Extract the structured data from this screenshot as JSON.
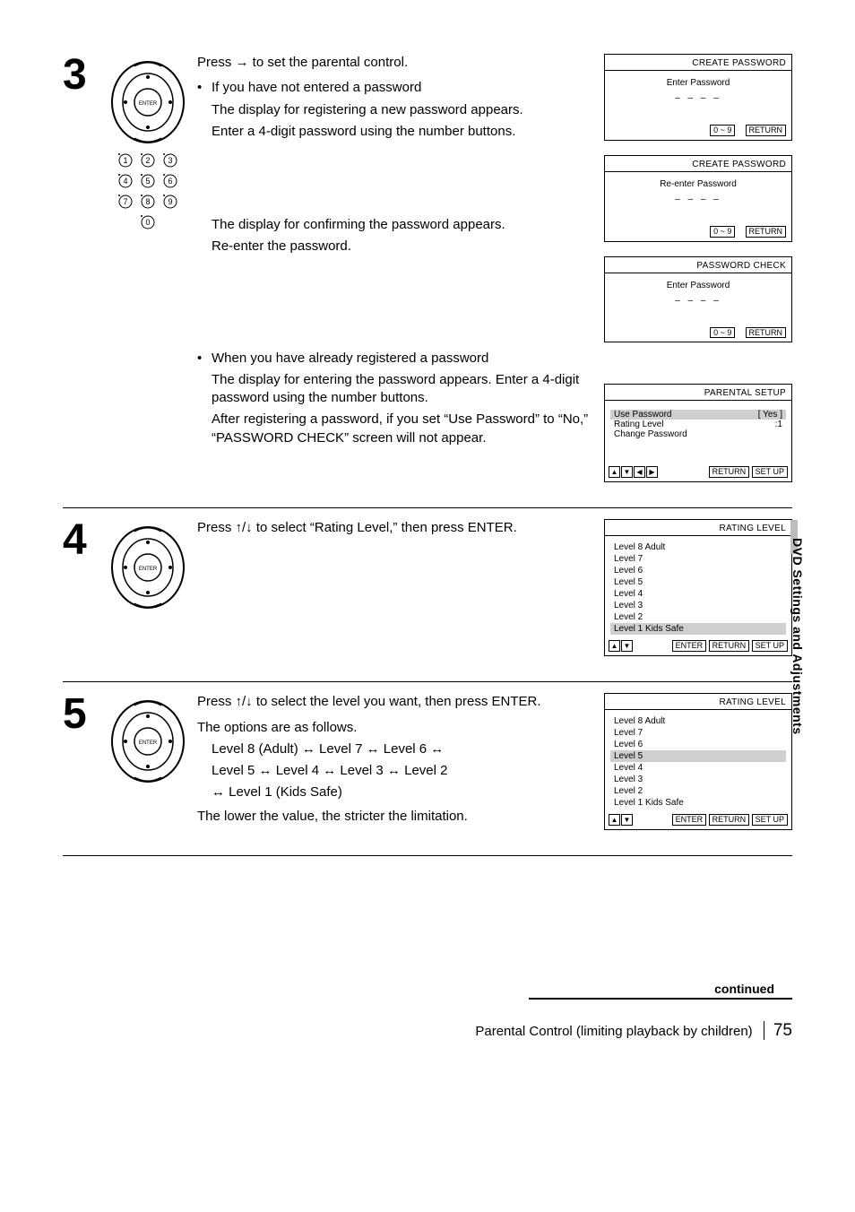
{
  "sideTab": "DVD Settings and Adjustments",
  "remote": {
    "enter": "ENTER"
  },
  "step3": {
    "num": "3",
    "intro": "Press → to set the parental control.",
    "b1": "If you have not entered a password",
    "b1a": "The display for registering a new password appears.",
    "b1b": "Enter a 4-digit password using the number buttons.",
    "b1c": "The display for confirming the password appears.",
    "b1d": "Re-enter the password.",
    "b2": "When you have already registered a password",
    "b2a": "The display for entering the password appears. Enter a 4-digit password using the number buttons.",
    "b2b": "After registering a password, if you set “Use Password” to “No,” “PASSWORD CHECK” screen will not appear.",
    "osd1": {
      "title": "CREATE PASSWORD",
      "prompt": "Enter Password",
      "dashes": "– – – –",
      "keys": "0 ~ 9",
      "ret": "RETURN"
    },
    "osd2": {
      "title": "CREATE PASSWORD",
      "prompt": "Re-enter Password",
      "dashes": "– – – –",
      "keys": "0 ~ 9",
      "ret": "RETURN"
    },
    "osd3": {
      "title": "PASSWORD CHECK",
      "prompt": "Enter Password",
      "dashes": "– – – –",
      "keys": "0 ~ 9",
      "ret": "RETURN"
    },
    "osd4": {
      "title": "PARENTAL SETUP",
      "p1l": "Use Password",
      "p1r": "[ Yes ]",
      "p2l": "Rating Level",
      "p2r": ":1",
      "p3l": "Change Password",
      "ret": "RETURN",
      "setup": "SET UP"
    }
  },
  "step4": {
    "num": "4",
    "intro": "Press ↑/↓ to select “Rating Level,” then press ENTER.",
    "osd": {
      "title": "RATING LEVEL",
      "rows": [
        "Level 8 Adult",
        "Level 7",
        "Level 6",
        "Level 5",
        "Level 4",
        "Level 3",
        "Level 2",
        "Level 1 Kids Safe"
      ],
      "hl": 7,
      "enter": "ENTER",
      "ret": "RETURN",
      "setup": "SET UP"
    }
  },
  "step5": {
    "num": "5",
    "intro": "Press ↑/↓ to select the level you want, then press ENTER.",
    "l2": "The options are as follows.",
    "chain1": "Level 8 (Adult) ↔ Level 7 ↔ Level 6 ↔",
    "chain2": "Level 5 ↔ Level 4 ↔ Level 3 ↔ Level 2",
    "chain3": "↔ Level 1 (Kids Safe)",
    "l3": "The lower the value, the stricter the limitation.",
    "osd": {
      "title": "RATING LEVEL",
      "rows": [
        "Level 8 Adult",
        "Level 7",
        "Level 6",
        "Level 5",
        "Level 4",
        "Level 3",
        "Level 2",
        "Level 1 Kids Safe"
      ],
      "hl": 3,
      "enter": "ENTER",
      "ret": "RETURN",
      "setup": "SET UP"
    }
  },
  "footer": {
    "continued": "continued",
    "title": "Parental Control (limiting playback by children)",
    "page": "75"
  }
}
